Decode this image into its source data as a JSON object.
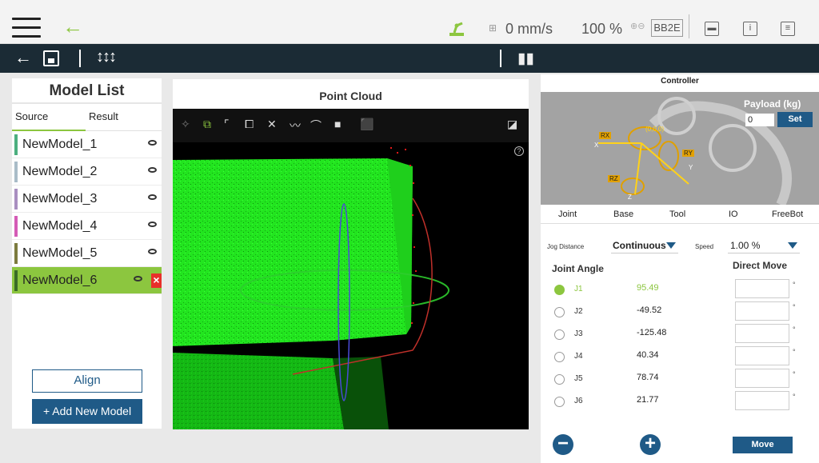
{
  "topbar": {
    "speed": "0 mm/s",
    "percent": "100 %",
    "robot_id": "BB2E"
  },
  "model_list": {
    "title": "Model List",
    "tabs": [
      "Source",
      "Result"
    ],
    "active_tab": "Source",
    "models": [
      {
        "name": "NewModel_1",
        "color": "#4caf7f"
      },
      {
        "name": "NewModel_2",
        "color": "#a9bcc8"
      },
      {
        "name": "NewModel_3",
        "color": "#a98fc0"
      },
      {
        "name": "NewModel_4",
        "color": "#d45bb6"
      },
      {
        "name": "NewModel_5",
        "color": "#7d7c3f"
      },
      {
        "name": "NewModel_6",
        "color": "#3a6b26",
        "selected": true
      }
    ],
    "align_label": "Align",
    "add_label": "+ Add New Model"
  },
  "point_cloud": {
    "title": "Point Cloud"
  },
  "controller": {
    "title": "Controller",
    "payload_label": "Payload (kg)",
    "payload_value": "0",
    "set_label": "Set",
    "axis_labels": {
      "rx": "RX",
      "ry": "RY",
      "rz": "RZ",
      "origin": "(0,0,0)",
      "x": "X",
      "y": "Y",
      "z": "Z"
    },
    "tabs": [
      "Joint",
      "Base",
      "Tool",
      "IO",
      "FreeBot"
    ],
    "jog_distance_label": "Jog Distance",
    "jog_distance_value": "Continuous",
    "speed_label": "Speed",
    "speed_value": "1.00 %",
    "joint_angle_heading": "Joint Angle",
    "direct_move_heading": "Direct Move",
    "joints": [
      {
        "name": "J1",
        "value": "95.49",
        "selected": true
      },
      {
        "name": "J2",
        "value": "-49.52"
      },
      {
        "name": "J3",
        "value": "-125.48"
      },
      {
        "name": "J4",
        "value": "40.34"
      },
      {
        "name": "J5",
        "value": "78.74"
      },
      {
        "name": "J6",
        "value": "21.77"
      }
    ],
    "degree_symbol": "°",
    "move_label": "Move"
  },
  "colors": {
    "accent_green": "#8cc63f",
    "nav_dark": "#1b2b35",
    "button_blue": "#1f5a87",
    "point_green": "#22e51f"
  }
}
